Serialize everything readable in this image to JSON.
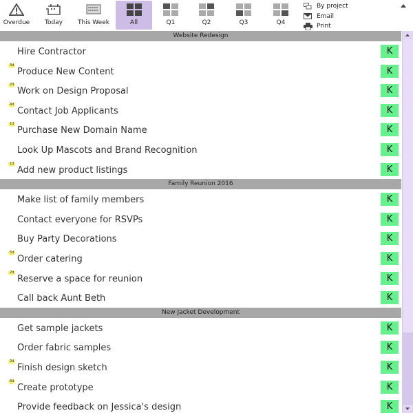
{
  "toolbar": {
    "filters": [
      {
        "label": "Overdue",
        "icon": "warning-triangle-icon",
        "active": false
      },
      {
        "label": "Today",
        "icon": "calendar-day-icon",
        "active": false
      },
      {
        "label": "This Week",
        "icon": "calendar-week-icon",
        "active": false
      },
      {
        "label": "All",
        "icon": "grid-all-icon",
        "active": true
      },
      {
        "label": "Q1",
        "icon": "quadrant-q1-icon",
        "active": false
      },
      {
        "label": "Q2",
        "icon": "quadrant-q2-icon",
        "active": false
      },
      {
        "label": "Q3",
        "icon": "quadrant-q3-icon",
        "active": false
      },
      {
        "label": "Q4",
        "icon": "quadrant-q4-icon",
        "active": false
      }
    ],
    "menu": [
      {
        "label": "By project",
        "icon": "group-icon"
      },
      {
        "label": "Email",
        "icon": "envelope-icon"
      },
      {
        "label": "Print",
        "icon": "printer-icon"
      }
    ]
  },
  "colors": {
    "active_filter": "#cdbde6",
    "section_header": "#a7a7a7",
    "k_badge": "#66f08e",
    "due_badge": "#f5f07a",
    "scrollbar_track": "#e8dcf8",
    "scrollbar_thumb": "#d6c7ec"
  },
  "sections": [
    {
      "title": "Website Redesign",
      "tasks": [
        {
          "title": "Hire Contractor",
          "due": "",
          "badge": "K"
        },
        {
          "title": "Produce New Content",
          "due": "3d",
          "badge": "K"
        },
        {
          "title": "Work on Design Proposal",
          "due": "2d",
          "badge": "K"
        },
        {
          "title": "Contact Job Applicants",
          "due": "4d",
          "badge": "K"
        },
        {
          "title": "Purchase New Domain Name",
          "due": "1d",
          "badge": "K"
        },
        {
          "title": "Look Up Mascots and Brand Recognition",
          "due": "",
          "badge": "K"
        },
        {
          "title": "Add new product listings",
          "due": "1d",
          "badge": "K"
        }
      ]
    },
    {
      "title": "Family Reunion 2016",
      "tasks": [
        {
          "title": "Make list of family members",
          "due": "",
          "badge": "K"
        },
        {
          "title": "Contact everyone for RSVPs",
          "due": "",
          "badge": "K"
        },
        {
          "title": "Buy Party Decorations",
          "due": "",
          "badge": "K"
        },
        {
          "title": "Order catering",
          "due": "5d",
          "badge": "K"
        },
        {
          "title": "Reserve a space for reunion",
          "due": "2d",
          "badge": "K"
        },
        {
          "title": "Call back Aunt Beth",
          "due": "",
          "badge": "K"
        }
      ]
    },
    {
      "title": "New Jacket Development",
      "tasks": [
        {
          "title": "Get sample jackets",
          "due": "",
          "badge": "K"
        },
        {
          "title": "Order fabric samples",
          "due": "",
          "badge": "K"
        },
        {
          "title": "Finish design sketch",
          "due": "2d",
          "badge": "K"
        },
        {
          "title": "Create prototype",
          "due": "6d",
          "badge": "K"
        },
        {
          "title": "Provide feedback on Jessica's design",
          "due": "",
          "badge": "K"
        }
      ]
    }
  ]
}
